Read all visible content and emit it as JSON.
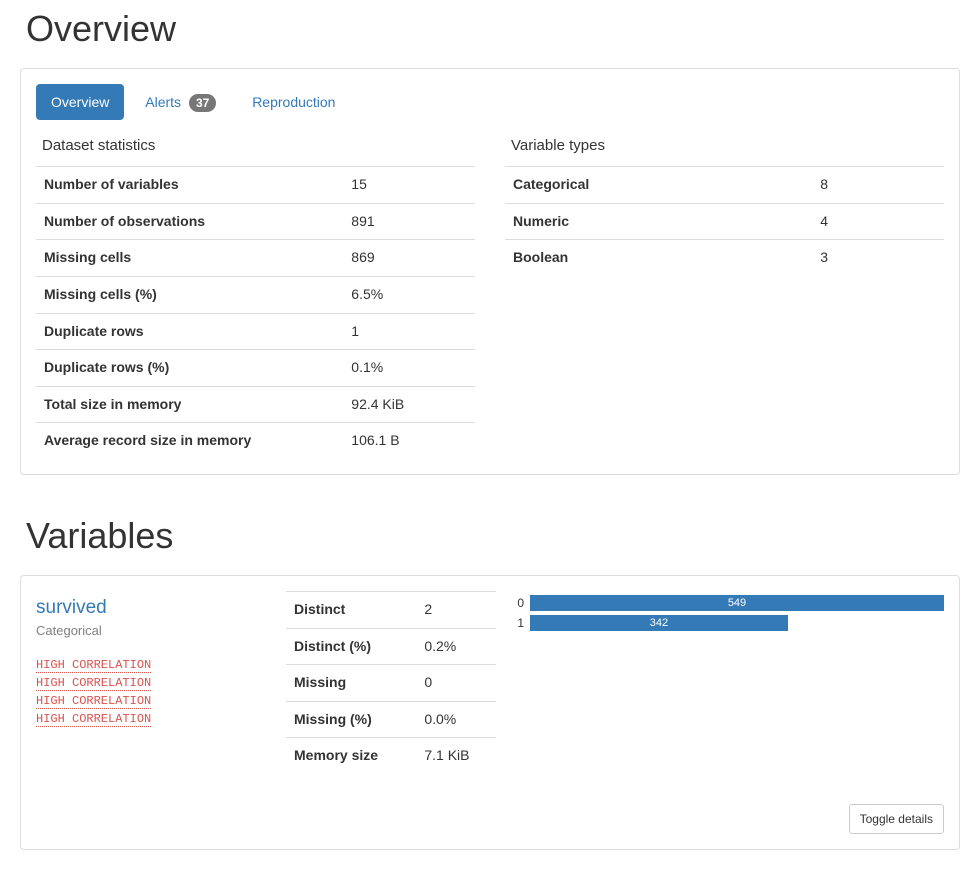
{
  "overview": {
    "title": "Overview",
    "tabs": {
      "overview": "Overview",
      "alerts": "Alerts",
      "alerts_count": "37",
      "reproduction": "Reproduction"
    },
    "dataset_stats_title": "Dataset statistics",
    "variable_types_title": "Variable types",
    "stats": {
      "n_var_label": "Number of variables",
      "n_var": "15",
      "n_obs_label": "Number of observations",
      "n_obs": "891",
      "missing_label": "Missing cells",
      "missing": "869",
      "missing_pct_label": "Missing cells (%)",
      "missing_pct": "6.5%",
      "dup_label": "Duplicate rows",
      "dup": "1",
      "dup_pct_label": "Duplicate rows (%)",
      "dup_pct": "0.1%",
      "size_label": "Total size in memory",
      "size": "92.4 KiB",
      "avg_rec_label": "Average record size in memory",
      "avg_rec": "106.1 B"
    },
    "types": {
      "cat_label": "Categorical",
      "cat": "8",
      "num_label": "Numeric",
      "num": "4",
      "bool_label": "Boolean",
      "bool": "3"
    }
  },
  "variables": {
    "title": "Variables",
    "survived": {
      "name": "survived",
      "type": "Categorical",
      "warnings": [
        "HIGH CORRELATION",
        "HIGH CORRELATION",
        "HIGH CORRELATION",
        "HIGH CORRELATION"
      ],
      "stats": {
        "distinct_label": "Distinct",
        "distinct": "2",
        "distinct_pct_label": "Distinct (%)",
        "distinct_pct": "0.2%",
        "missing_label": "Missing",
        "missing": "0",
        "missing_pct_label": "Missing (%)",
        "missing_pct": "0.0%",
        "mem_label": "Memory size",
        "mem": "7.1 KiB"
      },
      "toggle_label": "Toggle details"
    }
  },
  "chart_data": {
    "type": "bar",
    "orientation": "horizontal",
    "categories": [
      "0",
      "1"
    ],
    "values": [
      549,
      342
    ],
    "max": 549,
    "title": "",
    "xlabel": "",
    "ylabel": ""
  }
}
